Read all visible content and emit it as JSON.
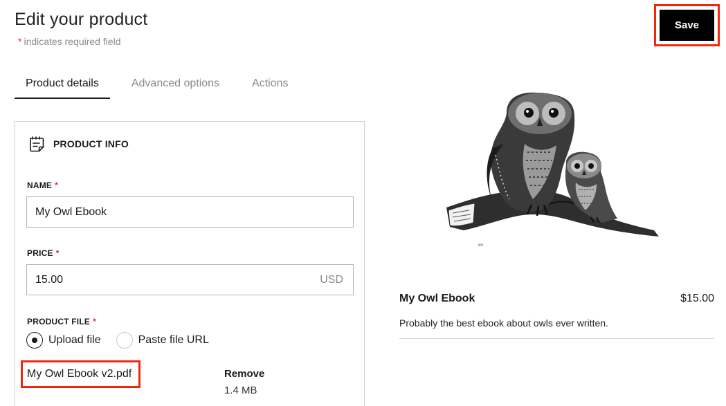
{
  "header": {
    "title": "Edit your product",
    "required_star": "*",
    "required_note": "indicates required field",
    "save_label": "Save"
  },
  "tabs": [
    {
      "label": "Product details",
      "active": true
    },
    {
      "label": "Advanced options",
      "active": false
    },
    {
      "label": "Actions",
      "active": false
    }
  ],
  "product_info": {
    "section_title": "PRODUCT INFO",
    "section_icon": "document-edit-icon",
    "name": {
      "label": "NAME",
      "star": "*",
      "value": "My Owl Ebook"
    },
    "price": {
      "label": "PRICE",
      "star": "*",
      "value": "15.00",
      "currency": "USD"
    },
    "product_file": {
      "label": "PRODUCT FILE",
      "star": "*",
      "options": [
        {
          "label": "Upload file",
          "selected": true
        },
        {
          "label": "Paste file URL",
          "selected": false
        }
      ],
      "file_name": "My Owl Ebook v2.pdf",
      "remove_label": "Remove",
      "file_size": "1.4 MB"
    }
  },
  "preview": {
    "image_icon": "owls-illustration",
    "name": "My Owl Ebook",
    "price": "$15.00",
    "description": "Probably the best ebook about owls ever written."
  },
  "colors": {
    "accent": "#000000",
    "highlight": "#f2260d",
    "required": "#d93025",
    "muted": "#8a8a8a"
  }
}
